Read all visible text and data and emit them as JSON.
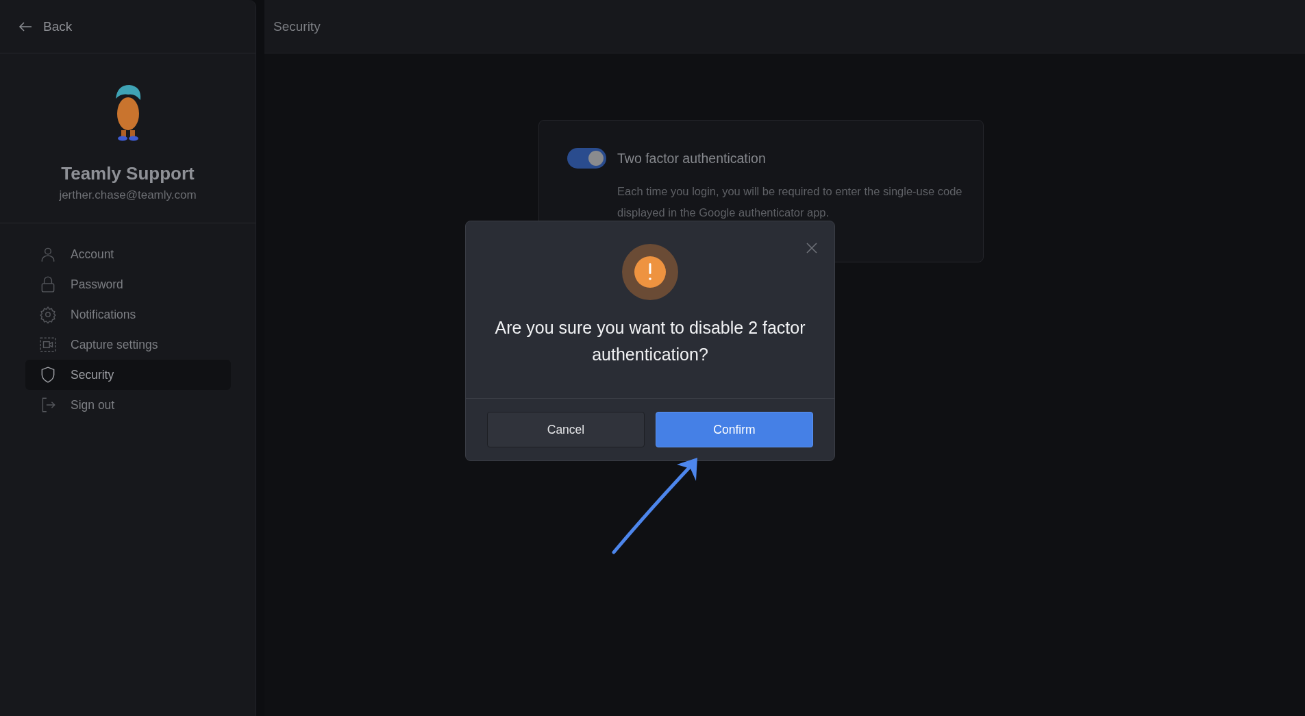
{
  "sidebar": {
    "back": "Back",
    "profile": {
      "name": "Teamly Support",
      "email": "jerther.chase@teamly.com"
    },
    "items": [
      {
        "label": "Account",
        "selected": false
      },
      {
        "label": "Password",
        "selected": false
      },
      {
        "label": "Notifications",
        "selected": false
      },
      {
        "label": "Capture settings",
        "selected": false
      },
      {
        "label": "Security",
        "selected": true
      },
      {
        "label": "Sign out",
        "selected": false
      }
    ]
  },
  "header": {
    "title": "Security"
  },
  "setting": {
    "title": "Two factor authentication",
    "on": true,
    "description": "Each time you login, you will be required to enter the single-use code displayed in the Google authenticator app."
  },
  "dialog": {
    "message": "Are you sure you want to disable 2 factor authentication?",
    "buttons": [
      {
        "label": "Cancel",
        "kind": "secondary"
      },
      {
        "label": "Confirm",
        "kind": "primary"
      }
    ]
  }
}
